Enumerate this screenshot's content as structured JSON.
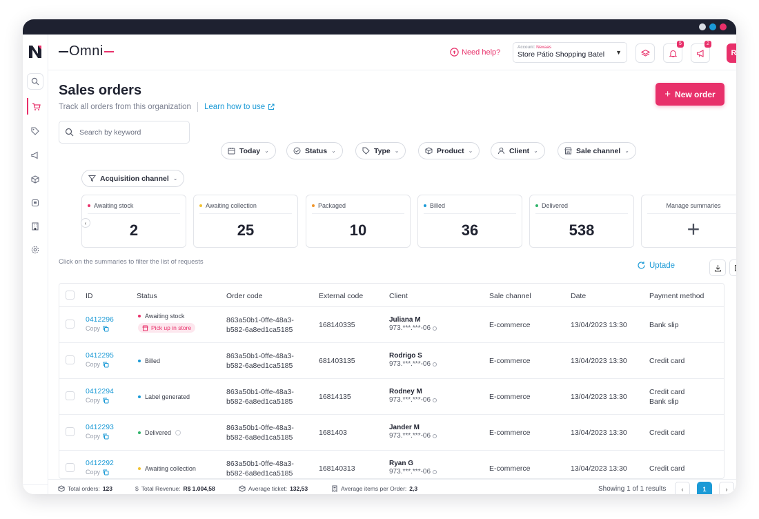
{
  "window": {
    "dot_colors": [
      "#d9dce3",
      "#1b9ad6",
      "#e8306a"
    ]
  },
  "header": {
    "brand": "Omni",
    "help_label": "Need help?",
    "account_label": "Account:",
    "account_name": "Nexaas",
    "store": "Store Pátio Shopping Batel",
    "notifications_count": "5",
    "announcements_count": "2",
    "avatar_initials": "RC"
  },
  "page": {
    "title": "Sales orders",
    "subtitle": "Track all orders from this organization",
    "learn_link": "Learn how to use",
    "new_order_label": "New order"
  },
  "filters": {
    "search_placeholder": "Search by keyword",
    "chips": [
      "Today",
      "Status",
      "Type",
      "Product",
      "Client",
      "Sale channel",
      "Acquisition channel"
    ]
  },
  "summaries": [
    {
      "label": "Awaiting stock",
      "value": "2",
      "color": "#e8306a"
    },
    {
      "label": "Awaiting collection",
      "value": "25",
      "color": "#f2c230"
    },
    {
      "label": "Packaged",
      "value": "10",
      "color": "#f0952a"
    },
    {
      "label": "Billed",
      "value": "36",
      "color": "#1b9ad6"
    },
    {
      "label": "Delivered",
      "value": "538",
      "color": "#2fb36a"
    }
  ],
  "manage_summaries_label": "Manage summaries",
  "hint": "Click on the summaries to filter the list of requests",
  "update_label": "Uptade",
  "table": {
    "headers": [
      "ID",
      "Status",
      "Order code",
      "External code",
      "Client",
      "Sale channel",
      "Date",
      "Payment method"
    ],
    "copy_label": "Copy",
    "pickup_label": "Pick up in store",
    "rows": [
      {
        "id": "0412296",
        "status": "Awaiting stock",
        "status_color": "#e8306a",
        "code1": "863a50b1-0ffe-48a3-",
        "code2": "b582-6a8ed1ca5185",
        "external": "168140335",
        "client": "Juliana M",
        "doc": "973.***.***-06",
        "channel": "E-commerce",
        "date": "13/04/2023 13:30",
        "payment": "Bank slip",
        "payment2": ""
      },
      {
        "id": "0412295",
        "status": "Billed",
        "status_color": "#1b9ad6",
        "code1": "863a50b1-0ffe-48a3-",
        "code2": "b582-6a8ed1ca5185",
        "external": "681403135",
        "client": "Rodrigo S",
        "doc": "973.***.***-06",
        "channel": "E-commerce",
        "date": "13/04/2023 13:30",
        "payment": "Credit card",
        "payment2": ""
      },
      {
        "id": "0412294",
        "status": "Label generated",
        "status_color": "#1b9ad6",
        "code1": "863a50b1-0ffe-48a3-",
        "code2": "b582-6a8ed1ca5185",
        "external": "16814135",
        "client": "Rodney M",
        "doc": "973.***.***-06",
        "channel": "E-commerce",
        "date": "13/04/2023 13:30",
        "payment": "Credit card",
        "payment2": "Bank slip"
      },
      {
        "id": "0412293",
        "status": "Delivered",
        "status_color": "#2fb36a",
        "code1": "863a50b1-0ffe-48a3-",
        "code2": "b582-6a8ed1ca5185",
        "external": "1681403",
        "client": "Jander M",
        "doc": "973.***.***-06",
        "channel": "E-commerce",
        "date": "13/04/2023 13:30",
        "payment": "Credit card",
        "payment2": ""
      },
      {
        "id": "0412292",
        "status": "Awaiting collection",
        "status_color": "#f2c230",
        "code1": "863a50b1-0ffe-48a3-",
        "code2": "b582-6a8ed1ca5185",
        "external": "168140313",
        "client": "Ryan G",
        "doc": "973.***.***-06",
        "channel": "E-commerce",
        "date": "13/04/2023 13:30",
        "payment": "Credit card",
        "payment2": ""
      }
    ]
  },
  "footer": {
    "total_orders_label": "Total orders:",
    "total_orders": "123",
    "total_revenue_label": "Total Revenue:",
    "total_revenue": "R$ 1.004,58",
    "avg_ticket_label": "Average ticket:",
    "avg_ticket": "132,53",
    "avg_items_label": "Average items per Order:",
    "avg_items": "2,3",
    "showing": "Showing 1 of 1 results",
    "current_page": "1"
  },
  "colors": {
    "accent": "#e8306a",
    "link": "#1b9ad6"
  }
}
